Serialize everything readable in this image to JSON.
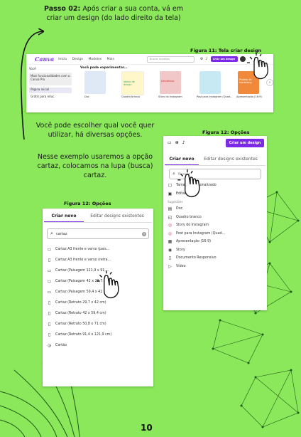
{
  "step": {
    "title": "Passo 02:",
    "text": "Após criar a sua conta, vá em criar um design (do lado direito da tela)"
  },
  "figure11": {
    "caption": "Figura 11: Tela criar design",
    "logo": "Canva",
    "nav": [
      "Início",
      "Design",
      "Modelos",
      "Mais"
    ],
    "search_placeholder": "Buscar modelos",
    "create_button": "Criar um design",
    "section_label": "Você pode experimentar...",
    "sidebar": [
      "Você",
      "Mais funcionalidades com o Canva Pro",
      "Página inicial",
      "Grátis para educ."
    ],
    "thumb_labels": [
      "Doc",
      "Quadro branco",
      "Story do Instagram",
      "Post para Instagram (Quad...",
      "Apresentação (16:9)"
    ],
    "thumb_text": [
      "Ideias de design",
      "Decidimos",
      "Projeto de Marketing"
    ]
  },
  "paragraph1": "Você pode escolher qual você quer utilizar, há diversas opções.",
  "paragraph2": "Nesse exemplo usaremos a opção cartaz, colocamos na lupa (busca) cartaz.",
  "figure12a": {
    "caption": "Figura 12: Opções",
    "create_button": "Criar um design",
    "tabs": [
      "Criar novo",
      "Editar designs existentes"
    ],
    "search_placeholder": "Buscar",
    "items_top": [
      "Tamanho personalizado",
      "Editar foto"
    ],
    "section": "Sugestões",
    "items": [
      "Doc",
      "Quadro branco",
      "Story do Instagram",
      "Post para Instagram (Quad...",
      "Apresentação (16:9)",
      "Story",
      "Documento Responsivo",
      "Vídeo"
    ]
  },
  "figure12b": {
    "caption": "Figura 12: Opções",
    "tabs": [
      "Criar novo",
      "Editar designs existentes"
    ],
    "search_value": "cartaz",
    "items": [
      "Cartaz A3 frente e verso (pais...",
      "Cartaz A3 frente e verso (retra...",
      "Cartaz (Paisagem 121,9 x 91,...",
      "Cartaz (Paisagem 42 x 29,7...",
      "Cartaz (Paisagem 59,4 x 42 c...",
      "Cartaz (Retrato 29,7 x 42 cm)",
      "Cartaz (Retrato 42 x 59,4 cm)",
      "Cartaz (Retrato 50,8 x 71 cm)",
      "Cartaz (Retrato 91,4 x 121,9 cm)",
      "Cartão"
    ]
  },
  "page_number": "10"
}
